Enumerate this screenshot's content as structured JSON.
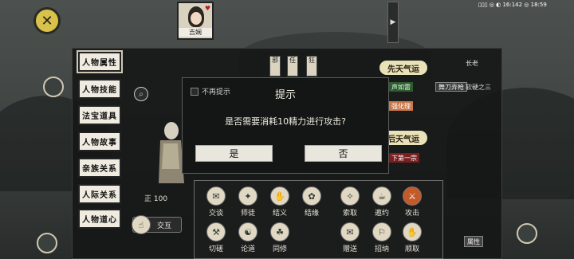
{
  "status": {
    "time_text": "▯▯▯ ◎ ◐ 16:142 ◎ 18:59"
  },
  "top_left": {
    "close_icon": "crossed-swords-icon"
  },
  "portrait": {
    "name": "吉娴",
    "icon": "heart-icon"
  },
  "sidebar": {
    "items": [
      {
        "label": "人物属性"
      },
      {
        "label": "人物技能"
      },
      {
        "label": "法宝道具"
      },
      {
        "label": "人物故事"
      },
      {
        "label": "亲族关系"
      },
      {
        "label": "人际关系"
      },
      {
        "label": "人物道心"
      }
    ]
  },
  "tabs": {
    "t1": "邪",
    "t2": "任",
    "t3": "狂"
  },
  "fate": {
    "innate_label": "先天气运",
    "acquired_label": "后天气运",
    "traits": [
      {
        "label": "声如雷"
      },
      {
        "label": "舞刀弄枪"
      },
      {
        "label": "强化理"
      },
      {
        "label": "下第一宗"
      }
    ],
    "right_labels": {
      "a": "长老",
      "b": "软硬之三"
    }
  },
  "character": {
    "hp": "正 100",
    "interact_label": "交互"
  },
  "dialog": {
    "no_remind": "不再提示",
    "title": "提示",
    "message": "是否需要消耗10精力进行攻击?",
    "yes": "是",
    "no": "否"
  },
  "actions": [
    {
      "label": "交谈"
    },
    {
      "label": "师徒"
    },
    {
      "label": "结义"
    },
    {
      "label": "结缘"
    },
    {
      "label": "索取"
    },
    {
      "label": "邀约"
    },
    {
      "label": "攻击"
    },
    {
      "label": "切磋"
    },
    {
      "label": "论道"
    },
    {
      "label": "同修"
    },
    {
      "label": "赠送"
    },
    {
      "label": "招纳"
    },
    {
      "label": "顺取"
    }
  ],
  "footer": {
    "property_label": "属性"
  }
}
